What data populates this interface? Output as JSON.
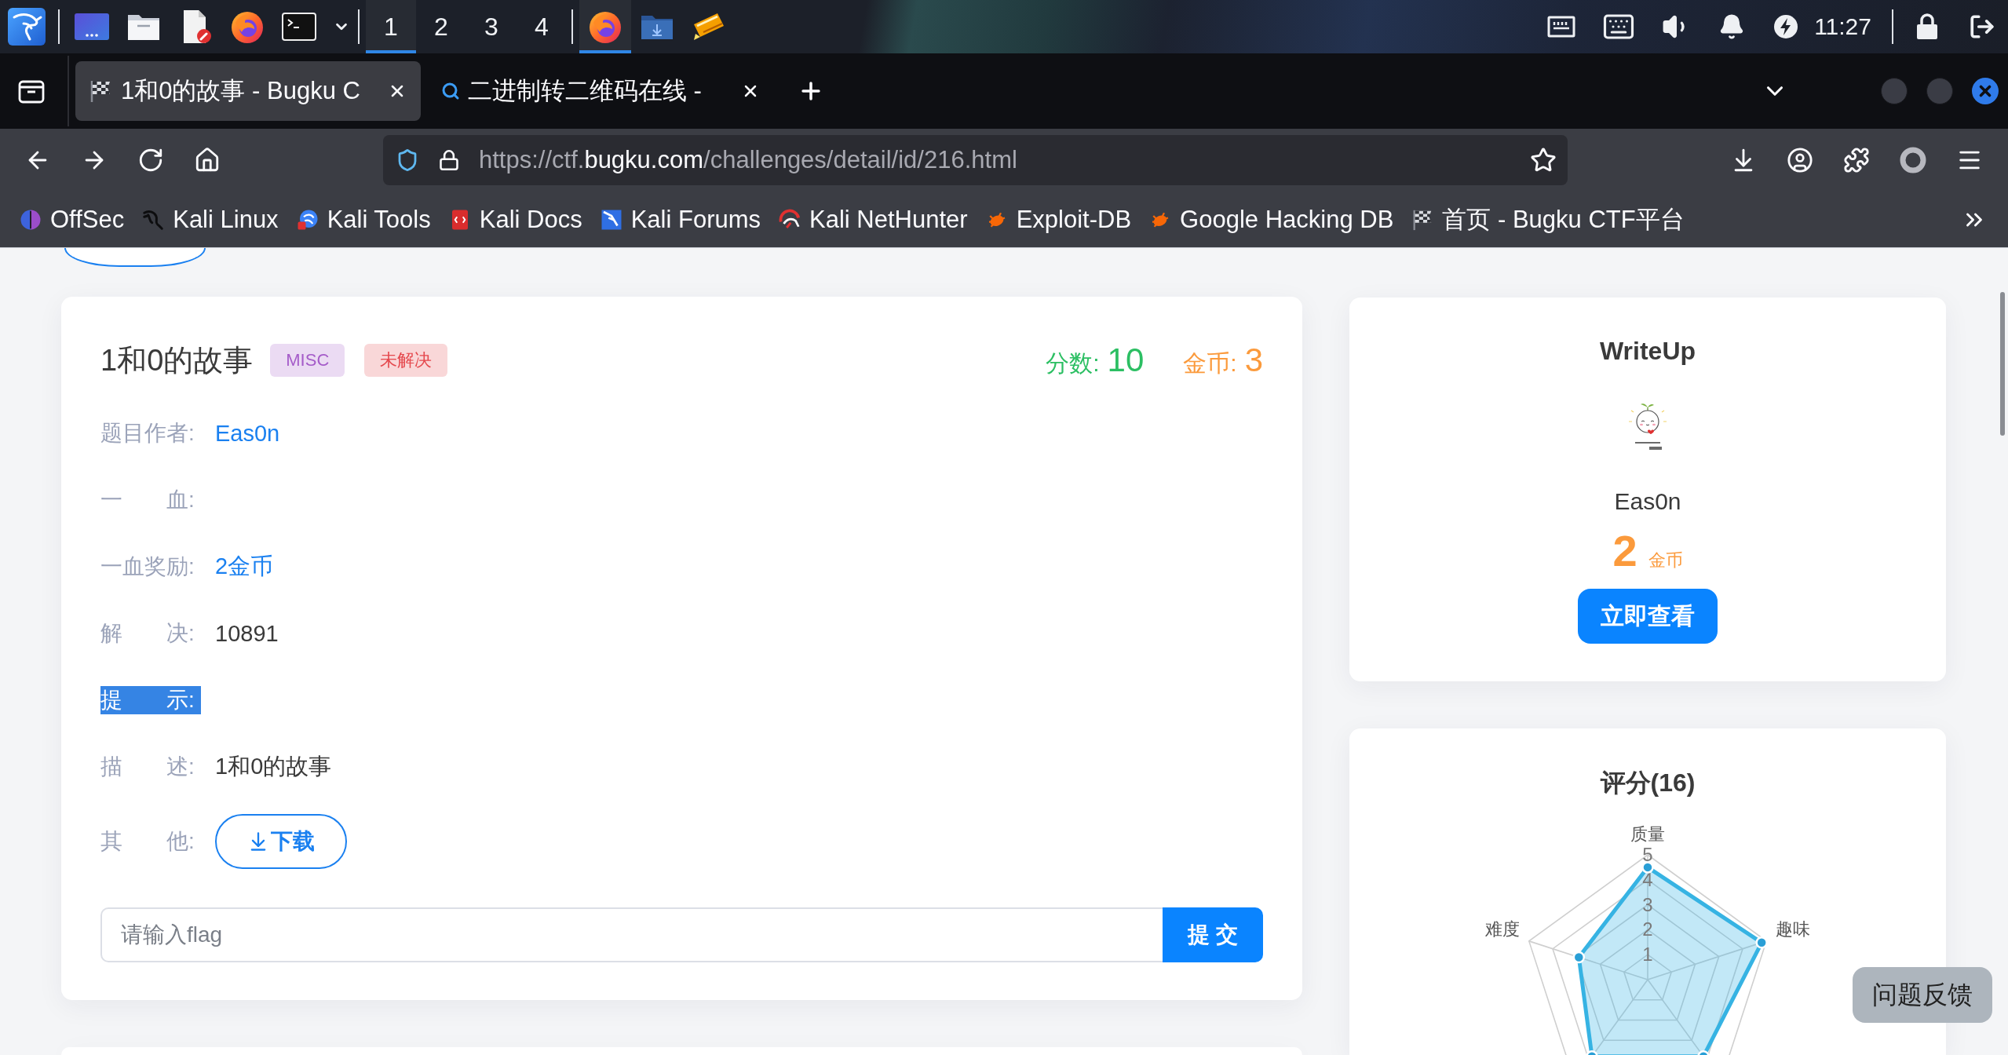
{
  "taskbar": {
    "workspaces": [
      {
        "label": "1",
        "selected": true
      },
      {
        "label": "2",
        "selected": false
      },
      {
        "label": "3",
        "selected": false
      },
      {
        "label": "4",
        "selected": false
      }
    ],
    "windows": [
      {
        "kind": "browser",
        "active": true
      },
      {
        "kind": "folder",
        "active": false
      },
      {
        "kind": "editor",
        "active": false
      }
    ],
    "time": "11:27"
  },
  "tabs": [
    {
      "title": "1和0的故事 - Bugku C",
      "kind": "flag",
      "selected": true
    },
    {
      "title": "二进制转二维码在线 -",
      "kind": "search",
      "selected": false
    }
  ],
  "address_bar": {
    "prefix": "https://ctf.",
    "host": "bugku.com",
    "path": "/challenges/detail/id/216.html"
  },
  "bookmarks": [
    {
      "label": "OffSec",
      "kind": "offsec"
    },
    {
      "label": "Kali Linux",
      "kind": "dragon"
    },
    {
      "label": "Kali Tools",
      "kind": "tools"
    },
    {
      "label": "Kali Docs",
      "kind": "docs"
    },
    {
      "label": "Kali Forums",
      "kind": "forums"
    },
    {
      "label": "Kali NetHunter",
      "kind": "nethunter"
    },
    {
      "label": "Exploit-DB",
      "kind": "bug"
    },
    {
      "label": "Google Hacking DB",
      "kind": "bug"
    },
    {
      "label": "首页 - Bugku CTF平台",
      "kind": "flag"
    }
  ],
  "challenge": {
    "title": "1和0的故事",
    "tags": [
      {
        "text": "MISC",
        "color": "#a55cc9"
      },
      {
        "text": "未解决",
        "color": "#e5484d"
      }
    ],
    "score": {
      "label": "分数:",
      "value": "10"
    },
    "coins": {
      "label": "金币:",
      "value": "3"
    },
    "fields": [
      {
        "label": "题目作者:",
        "kind": "link",
        "value": "Eas0n",
        "highlighted": false
      },
      {
        "label": "一　　血:",
        "kind": "empty",
        "highlighted": false
      },
      {
        "label": "一血奖励:",
        "kind": "link",
        "value": "2金币",
        "highlighted": false
      },
      {
        "label": "解　　决:",
        "kind": "text",
        "value": "10891",
        "highlighted": false
      },
      {
        "label": "提　　示:",
        "kind": "empty",
        "highlighted": true
      },
      {
        "label": "描　　述:",
        "kind": "text",
        "value": "1和0的故事",
        "highlighted": false
      },
      {
        "label": "其　　他:",
        "kind": "download",
        "value": "下载",
        "highlighted": false
      }
    ],
    "flag_input": {
      "placeholder": "请输入flag"
    },
    "submit": "提 交"
  },
  "writeup": {
    "title": "WriteUp",
    "author": "Eas0n",
    "coins": "2",
    "coins_unit": "金币",
    "button": "立即查看"
  },
  "rating": {
    "title": "评分(16)",
    "axis_labels": [
      "质量",
      "趣味",
      "难度"
    ],
    "ticks": [
      "5",
      "4",
      "3",
      "2",
      "1"
    ]
  },
  "feedback_button": "问题反馈"
}
